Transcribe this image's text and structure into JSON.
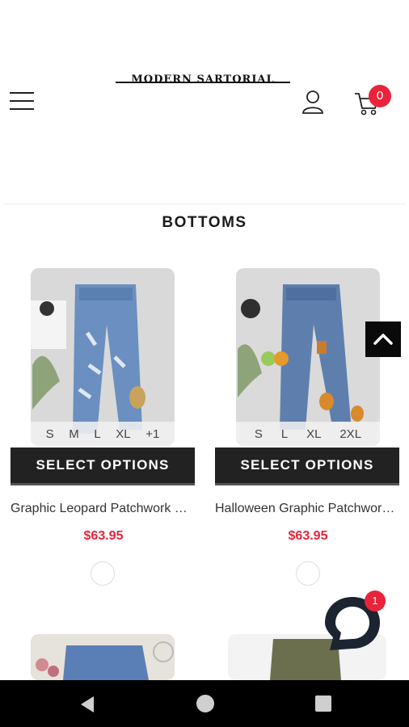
{
  "header": {
    "logo_text": "MODERN SARTORIAL",
    "menu_icon": "hamburger-menu-icon",
    "account_icon": "user-icon",
    "cart_icon": "shopping-cart-icon",
    "cart_count": "0"
  },
  "section": {
    "title": "BOTTOMS"
  },
  "products": [
    {
      "sizes": [
        "S",
        "M",
        "L",
        "XL",
        "+1"
      ],
      "button_label": "SELECT OPTIONS",
      "name": "Graphic Leopard Patchwork Ripped Jeans",
      "price": "$63.95"
    },
    {
      "sizes": [
        "S",
        "L",
        "XL",
        "2XL"
      ],
      "button_label": "SELECT OPTIONS",
      "name": "Halloween Graphic Patchwork Jeans",
      "price": "$63.95"
    }
  ],
  "back_to_top_icon": "chevron-up-icon",
  "chat": {
    "icon": "chat-bubble-icon",
    "unread_count": "1"
  },
  "system_nav": {
    "back_icon": "back-triangle-icon",
    "home_icon": "home-circle-icon",
    "recents_icon": "recents-square-icon"
  },
  "colors": {
    "accent": "#e8243b",
    "button_bg": "#222222",
    "nav_bg": "#000000"
  }
}
